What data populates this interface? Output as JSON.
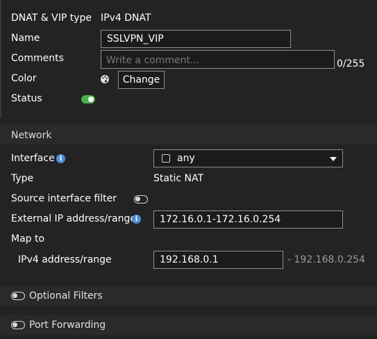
{
  "dnat_vip_type": {
    "label": "DNAT & VIP type",
    "value": "IPv4 DNAT"
  },
  "name": {
    "label": "Name",
    "value": "SSLVPN_VIP"
  },
  "comments": {
    "label": "Comments",
    "placeholder": "Write a comment...",
    "counter": "0/255"
  },
  "color": {
    "label": "Color",
    "change_label": "Change"
  },
  "status": {
    "label": "Status",
    "enabled": true
  },
  "network": {
    "header": "Network",
    "interface": {
      "label": "Interface",
      "value": "any"
    },
    "type": {
      "label": "Type",
      "value": "Static NAT"
    },
    "source_interface_filter": {
      "label": "Source interface filter",
      "enabled": false
    },
    "external_ip": {
      "label": "External IP address/range",
      "value": "172.16.0.1-172.16.0.254"
    },
    "map_to": {
      "label": "Map to",
      "ipv4": {
        "label": "IPv4 address/range",
        "value": "192.168.0.1",
        "range_end": "- 192.168.0.254"
      }
    }
  },
  "optional_filters": {
    "label": "Optional Filters",
    "enabled": false
  },
  "port_forwarding": {
    "label": "Port Forwarding",
    "enabled": false
  },
  "colors": {
    "toggle_on": "#4cae4c",
    "info_icon": "#4a8fd6",
    "background": "#232323"
  }
}
